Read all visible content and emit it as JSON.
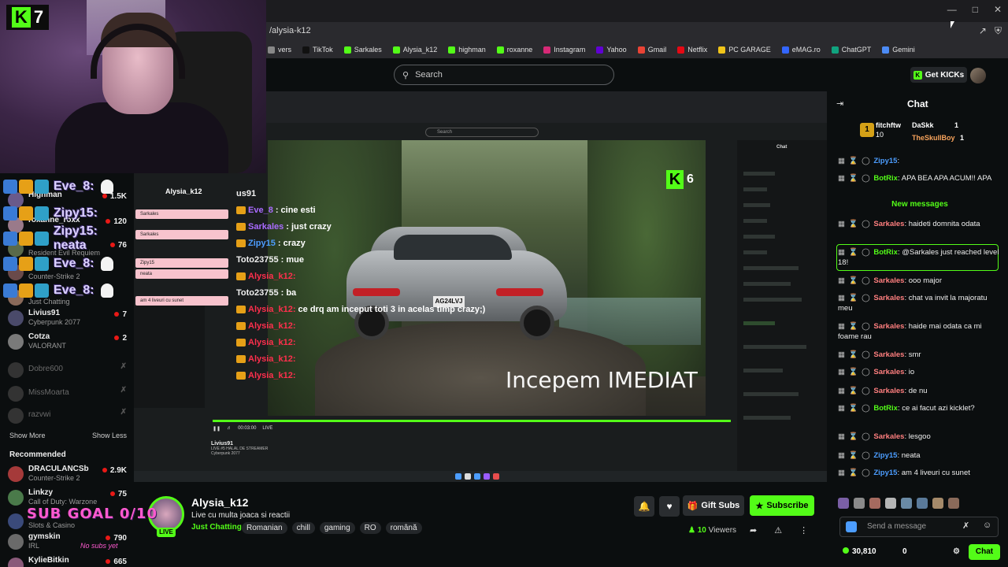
{
  "browser": {
    "url": "/alysia-k12",
    "bookmarks": [
      "vers",
      "TikTok",
      "Sarkales",
      "Alysia_k12",
      "highman",
      "roxanne",
      "Instagram",
      "Yahoo",
      "Gmail",
      "Netflix",
      "PC GARAGE",
      "eMAG.ro",
      "ChatGPT",
      "Gemini"
    ],
    "bookmark_colors": [
      "#888888",
      "#111111",
      "#53fc18",
      "#53fc18",
      "#53fc18",
      "#53fc18",
      "#d62976",
      "#6001d2",
      "#ea4335",
      "#e50914",
      "#f0c419",
      "#3366ff",
      "#10a37f",
      "#4c8bf5"
    ]
  },
  "header": {
    "search_placeholder": "Search",
    "get_kicks_label": "Get KICKs"
  },
  "webcam": {
    "badge_number": "7"
  },
  "sidebar": {
    "following": [
      {
        "name": "Highman",
        "category": "",
        "count": "1.5K"
      },
      {
        "name": "roxanne_roxx",
        "category": "",
        "count": "120"
      },
      {
        "name": "",
        "category": "Resident Evil Requiem",
        "count": "76"
      },
      {
        "name": "",
        "category": "Counter-Strike 2",
        "count": ""
      },
      {
        "name": "",
        "category": "Just Chatting",
        "count": ""
      },
      {
        "name": "Livius91",
        "category": "Cyberpunk 2077",
        "count": "7"
      },
      {
        "name": "Cotza",
        "category": "VALORANT",
        "count": "2"
      }
    ],
    "offline": [
      "Dobre600",
      "MissMoarta",
      "razvwi"
    ],
    "show_more": "Show More",
    "show_less": "Show Less",
    "recommended_title": "Recommended",
    "recommended": [
      {
        "name": "DRACULANCSb",
        "category": "Counter-Strike 2",
        "count": "2.9K"
      },
      {
        "name": "Linkzy",
        "category": "Call of Duty: Warzone",
        "count": "75"
      },
      {
        "name": "",
        "category": "Slots & Casino",
        "count": ""
      },
      {
        "name": "gymskin",
        "category": "IRL",
        "count": "790"
      },
      {
        "name": "KylieBitkin",
        "category": "",
        "count": "665"
      }
    ],
    "alerts": [
      {
        "text": "Eve_8:"
      },
      {
        "text": "Zipy15:"
      },
      {
        "text": "Zipy15: neata"
      },
      {
        "text": "Eve_8:"
      },
      {
        "text": "Eve_8:"
      }
    ]
  },
  "video": {
    "kick_counter": "6",
    "overlay_text": "Incepem IMEDIAT",
    "alysia_name": "Alysia_k12",
    "overlay_chat": [
      {
        "user": "us91",
        "msg": "",
        "color": "white"
      },
      {
        "user": "Eve_8",
        "msg": ": cine esti",
        "color": "purple"
      },
      {
        "user": "Sarkales",
        "msg": ": just crazy",
        "color": "purple"
      },
      {
        "user": "Zipy15",
        "msg": ": crazy",
        "color": "blue"
      },
      {
        "user": "Toto23755",
        "msg": ": mue",
        "color": "white"
      },
      {
        "user": "Alysia_k12:",
        "msg": "",
        "color": "red"
      },
      {
        "user": "Toto23755",
        "msg": ": ba",
        "color": "white"
      },
      {
        "user": "Alysia_k12:",
        "msg": " ce drq am inceput toti 3 in acelas timp crazy;)",
        "color": "red"
      },
      {
        "user": "Alysia_k12:",
        "msg": "",
        "color": "red"
      },
      {
        "user": "Alysia_k12:",
        "msg": "",
        "color": "red"
      },
      {
        "user": "Alysia_k12:",
        "msg": "",
        "color": "red"
      },
      {
        "user": "Alysia_k12:",
        "msg": "",
        "color": "red"
      }
    ],
    "player_time": "00:03:00",
    "player_live": "LIVE",
    "inner_streamer": "Livius91",
    "inner_title": "LIVE #5 HALAL DE STREAMER",
    "inner_category": "Cyberpunk 2077"
  },
  "stream": {
    "streamer_name": "Alysia_k12",
    "title": "Live cu multa joaca si reactii",
    "category": "Just Chatting",
    "tags": [
      "Romanian",
      "chill",
      "gaming",
      "RO",
      "română"
    ],
    "live_label": "LIVE",
    "gift_subs_label": "Gift Subs",
    "subscribe_label": "Subscribe",
    "viewers_count": "10",
    "viewers_label": "Viewers",
    "sub_goal_text": "SUB GOAL 0/10",
    "no_subs_text": "No subs yet"
  },
  "chat": {
    "title": "Chat",
    "gifter": {
      "name": "fitchftw",
      "count": "10",
      "rank": "1"
    },
    "pinned_users": [
      {
        "name": "DaSkk",
        "count": "1"
      },
      {
        "name": "TheSkullBoy",
        "count": "1"
      }
    ],
    "messages": [
      {
        "user": "Zipy15",
        "text": ":",
        "cls": "u-zipy"
      },
      {
        "user": "BotRix",
        "text": ": APA BEA APA ACUM!! APA",
        "cls": "u-bot"
      },
      {
        "user": "Sarkales",
        "text": ": haideti domnita odata",
        "cls": "u-sark"
      },
      {
        "user": "BotRix",
        "text": ": @Sarkales just reached level 18!",
        "cls": "u-bot"
      },
      {
        "user": "Sarkales",
        "text": ": ooo major",
        "cls": "u-sark"
      },
      {
        "user": "Sarkales",
        "text": ": chat va invit la majoratu meu",
        "cls": "u-sark"
      },
      {
        "user": "Sarkales",
        "text": ": haide mai odata ca mi foame rau",
        "cls": "u-sark"
      },
      {
        "user": "Sarkales",
        "text": ": smr",
        "cls": "u-sark"
      },
      {
        "user": "Sarkales",
        "text": ": io",
        "cls": "u-sark"
      },
      {
        "user": "Sarkales",
        "text": ": de nu",
        "cls": "u-sark"
      },
      {
        "user": "BotRix",
        "text": ": ce ai facut azi kicklet?",
        "cls": "u-bot"
      },
      {
        "user": "Sarkales",
        "text": ": lesgoo",
        "cls": "u-sark"
      },
      {
        "user": "Zipy15",
        "text": ": neata",
        "cls": "u-zipy"
      },
      {
        "user": "Zipy15",
        "text": ": am 4 liveuri cu sunet",
        "cls": "u-zipy"
      }
    ],
    "new_messages_label": "New messages",
    "send_placeholder": "Send a message",
    "points": "30,810",
    "kicks": "0",
    "chat_button": "Chat"
  }
}
